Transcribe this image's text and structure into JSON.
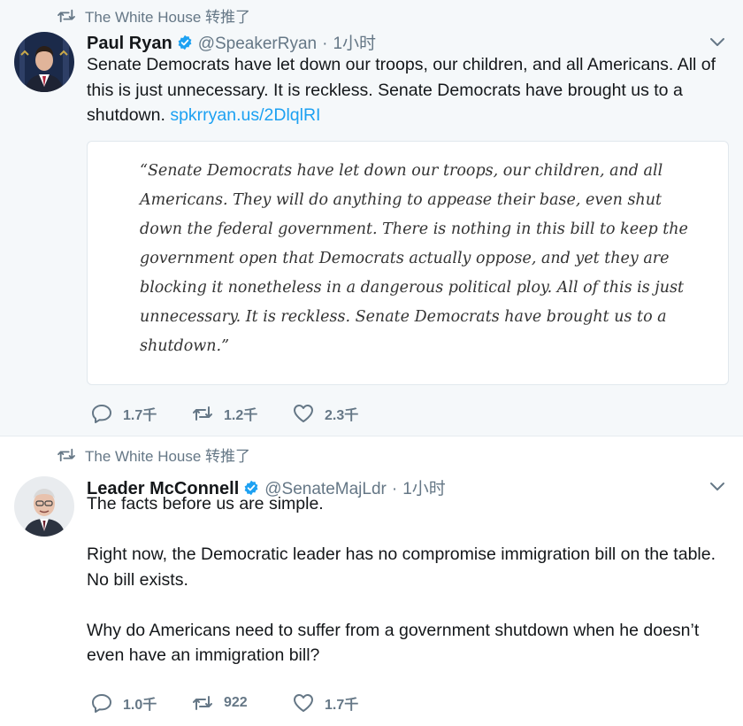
{
  "tweets": [
    {
      "retweet_context": "The White House 转推了",
      "author_name": "Paul Ryan",
      "verified": true,
      "handle": "@SpeakerRyan",
      "separator": "·",
      "time": "1小时",
      "text_main": "Senate Democrats have let down our troops, our children, and all Americans. All of this is just unnecessary. It is reckless. Senate Democrats have brought us to a shutdown.",
      "text_link": "spkrryan.us/2DlqlRI",
      "quote_card": "“Senate Democrats have let down our troops, our children, and all Americans. They will do anything to appease their base, even shut down the federal government. There is nothing in this bill to keep the government open that Democrats actually oppose, and yet they are blocking it nonetheless in a dangerous political ploy. All of this is just unnecessary. It is reckless. Senate Democrats have brought us to a shutdown.”",
      "replies": "1.7千",
      "retweets": "1.2千",
      "likes": "2.3千"
    },
    {
      "retweet_context": "The White House 转推了",
      "author_name": "Leader McConnell",
      "verified": true,
      "handle": "@SenateMajLdr",
      "separator": "·",
      "time": "1小时",
      "paragraphs": [
        "The facts before us are simple.",
        "Right now, the Democratic leader has no compromise immigration bill on the table. No bill exists.",
        "Why do Americans need to suffer from a government shutdown when he doesn’t even have an immigration bill?"
      ],
      "replies": "1.0千",
      "retweets": "922",
      "likes": "1.7千"
    }
  ],
  "colors": {
    "accent": "#1da1f2",
    "secondary_text": "#657786",
    "highlight_bg": "#f5f8fa"
  },
  "icons": [
    "retweet-icon",
    "verified-badge-icon",
    "chevron-down-icon",
    "reply-icon",
    "like-icon"
  ]
}
